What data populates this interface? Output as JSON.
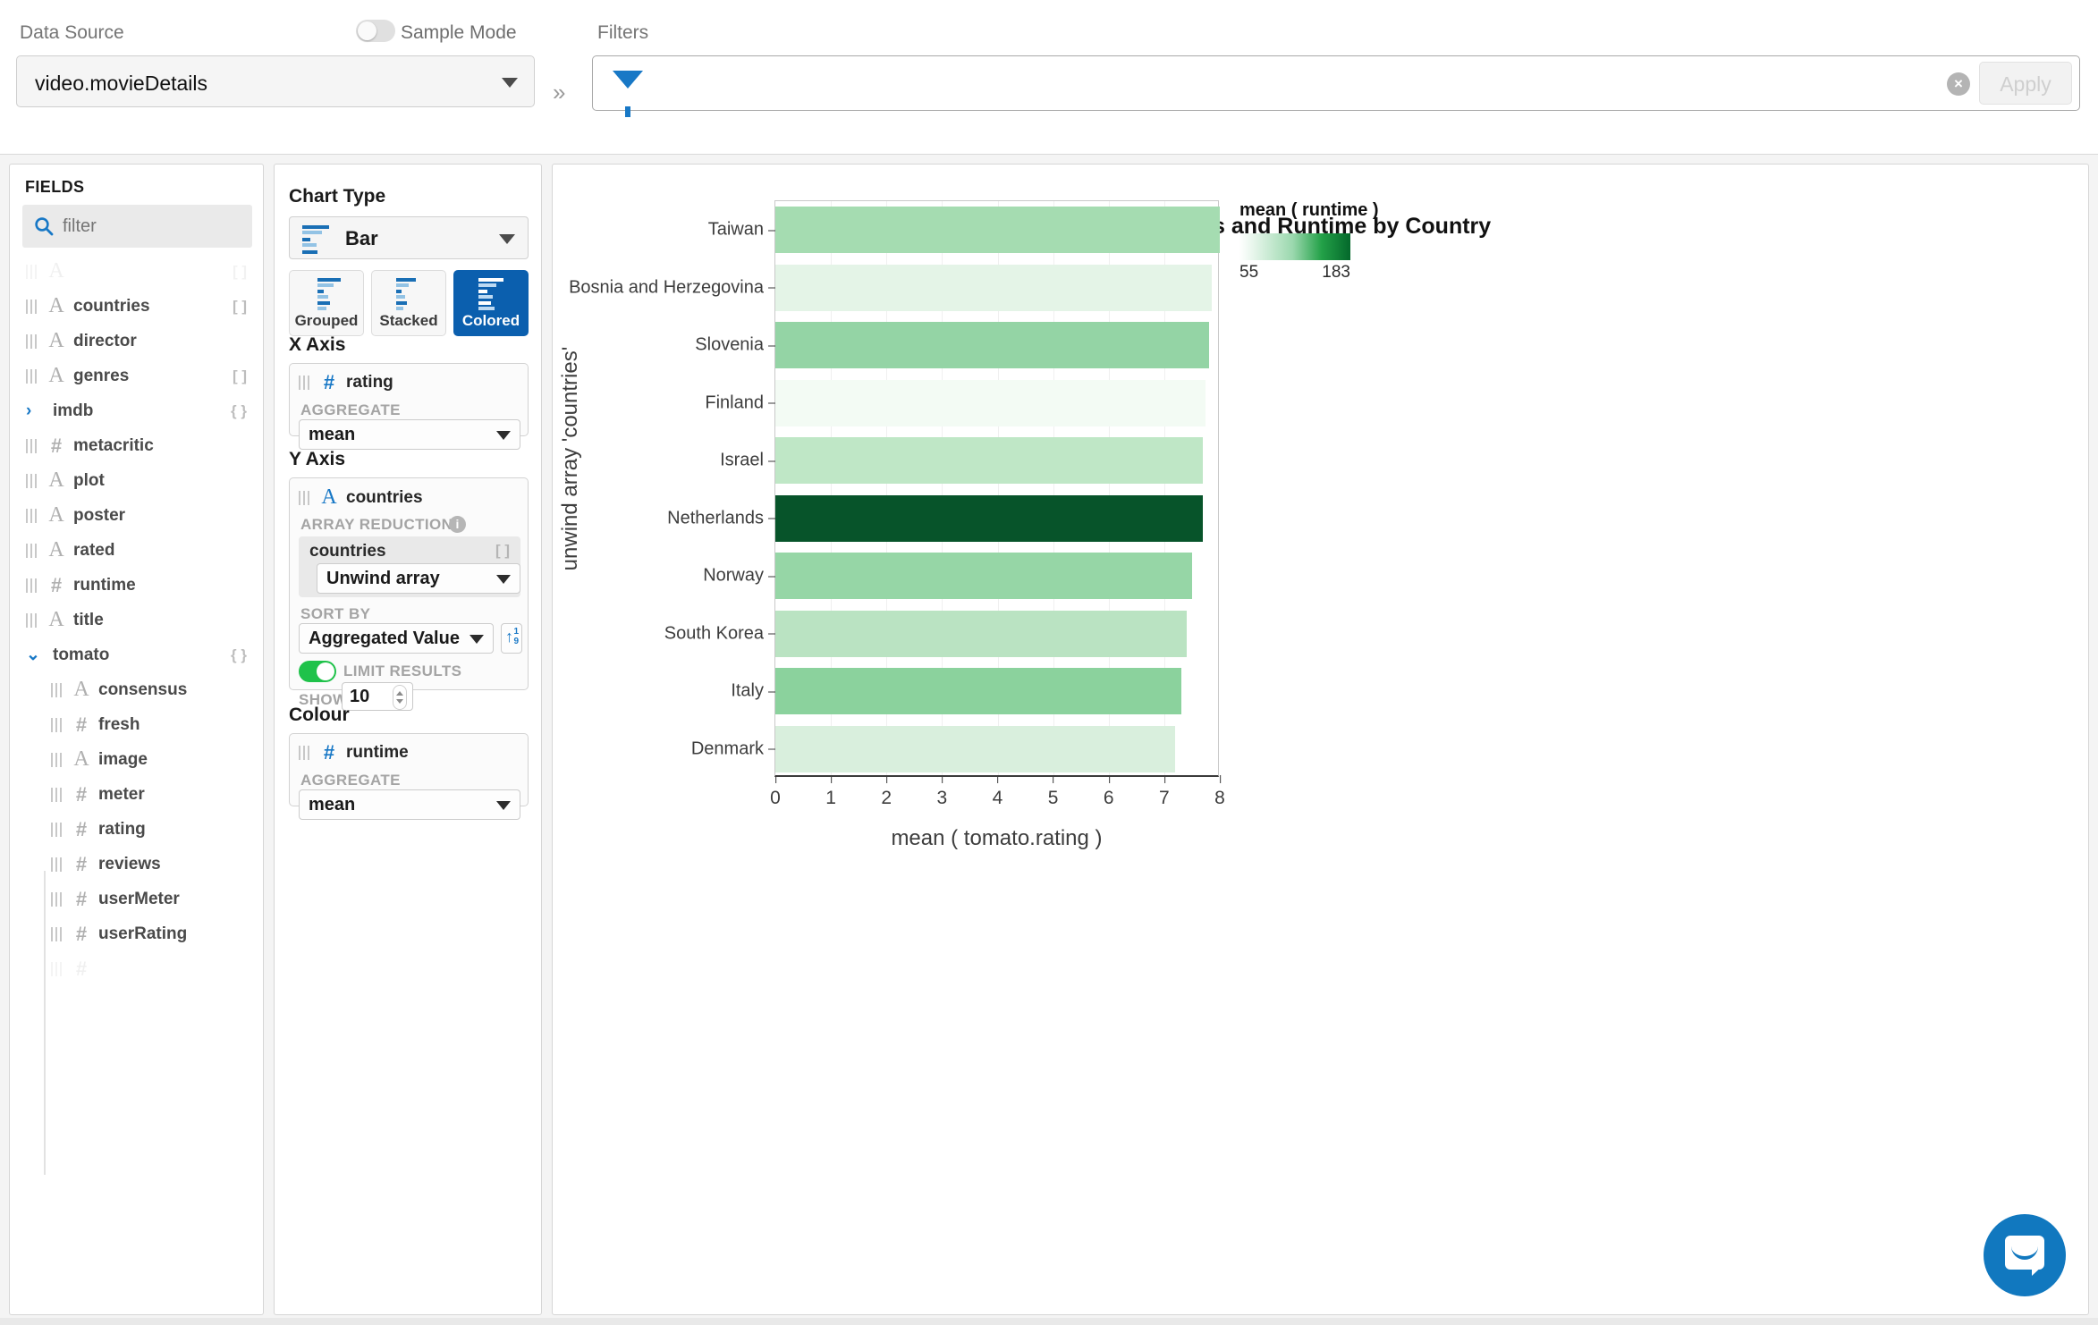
{
  "topbar": {
    "data_source_label": "Data Source",
    "data_source_value": "video.movieDetails",
    "sample_mode_label": "Sample Mode",
    "sample_mode_on": false,
    "expand_icon": "»",
    "filters_label": "Filters",
    "filter_clear_icon": "×",
    "apply_label": "Apply"
  },
  "fields": {
    "title": "FIELDS",
    "filter_placeholder": "filter",
    "items": [
      {
        "name": "",
        "type": "string",
        "bracket": "[ ]",
        "indent": 0,
        "faded": true,
        "expander": ""
      },
      {
        "name": "countries",
        "type": "string",
        "bracket": "[ ]",
        "indent": 0,
        "faded": false,
        "expander": ""
      },
      {
        "name": "director",
        "type": "string",
        "bracket": "",
        "indent": 0,
        "faded": false,
        "expander": ""
      },
      {
        "name": "genres",
        "type": "string",
        "bracket": "[ ]",
        "indent": 0,
        "faded": false,
        "expander": ""
      },
      {
        "name": "imdb",
        "type": "object",
        "bracket": "{ }",
        "indent": 0,
        "faded": false,
        "expander": "›"
      },
      {
        "name": "metacritic",
        "type": "number",
        "bracket": "",
        "indent": 0,
        "faded": false,
        "expander": ""
      },
      {
        "name": "plot",
        "type": "string",
        "bracket": "",
        "indent": 0,
        "faded": false,
        "expander": ""
      },
      {
        "name": "poster",
        "type": "string",
        "bracket": "",
        "indent": 0,
        "faded": false,
        "expander": ""
      },
      {
        "name": "rated",
        "type": "string",
        "bracket": "",
        "indent": 0,
        "faded": false,
        "expander": ""
      },
      {
        "name": "runtime",
        "type": "number",
        "bracket": "",
        "indent": 0,
        "faded": false,
        "expander": ""
      },
      {
        "name": "title",
        "type": "string",
        "bracket": "",
        "indent": 0,
        "faded": false,
        "expander": ""
      },
      {
        "name": "tomato",
        "type": "object",
        "bracket": "{ }",
        "indent": 0,
        "faded": false,
        "expander": "⌄"
      },
      {
        "name": "consensus",
        "type": "string",
        "bracket": "",
        "indent": 1,
        "faded": false,
        "expander": ""
      },
      {
        "name": "fresh",
        "type": "number",
        "bracket": "",
        "indent": 1,
        "faded": false,
        "expander": ""
      },
      {
        "name": "image",
        "type": "string",
        "bracket": "",
        "indent": 1,
        "faded": false,
        "expander": ""
      },
      {
        "name": "meter",
        "type": "number",
        "bracket": "",
        "indent": 1,
        "faded": false,
        "expander": ""
      },
      {
        "name": "rating",
        "type": "number",
        "bracket": "",
        "indent": 1,
        "faded": false,
        "expander": ""
      },
      {
        "name": "reviews",
        "type": "number",
        "bracket": "",
        "indent": 1,
        "faded": false,
        "expander": ""
      },
      {
        "name": "userMeter",
        "type": "number",
        "bracket": "",
        "indent": 1,
        "faded": false,
        "expander": ""
      },
      {
        "name": "userRating",
        "type": "number",
        "bracket": "",
        "indent": 1,
        "faded": false,
        "expander": ""
      },
      {
        "name": "",
        "type": "number",
        "bracket": "",
        "indent": 1,
        "faded": true,
        "expander": ""
      }
    ]
  },
  "config": {
    "chart_type_heading": "Chart Type",
    "chart_type_value": "Bar",
    "variants": [
      {
        "label": "Grouped",
        "active": false
      },
      {
        "label": "Stacked",
        "active": false
      },
      {
        "label": "Colored",
        "active": true
      }
    ],
    "x_axis": {
      "heading": "X Axis",
      "field": "rating",
      "field_type": "number",
      "aggregate_label": "AGGREGATE",
      "aggregate_value": "mean"
    },
    "y_axis": {
      "heading": "Y Axis",
      "field": "countries",
      "field_type": "string",
      "array_reductions_label": "ARRAY REDUCTIONS",
      "info_icon": "i",
      "reduction_field": "countries",
      "reduction_bracket": "[ ]",
      "reduction_value": "Unwind array",
      "sort_by_label": "SORT BY",
      "sort_by_value": "Aggregated Value",
      "sort_dir_icon": "↑",
      "sort_dir_nums": "1\n9",
      "limit_results_label": "LIMIT RESULTS",
      "limit_results_on": true,
      "show_label": "SHOW:",
      "show_value": "10"
    },
    "colour": {
      "heading": "Colour",
      "field": "runtime",
      "field_type": "number",
      "aggregate_label": "AGGREGATE",
      "aggregate_value": "mean"
    }
  },
  "chart_data": {
    "type": "bar",
    "orientation": "horizontal",
    "title": "Average Movie Ratings and Runtime by Country",
    "xlabel": "mean ( tomato.rating )",
    "ylabel": "unwind array 'countries'",
    "xlim": [
      0,
      8
    ],
    "xticks": [
      "0",
      "1",
      "2",
      "3",
      "4",
      "5",
      "6",
      "7",
      "8"
    ],
    "grid": true,
    "categories": [
      "Taiwan",
      "Bosnia and Herzegovina",
      "Slovenia",
      "Finland",
      "Israel",
      "Netherlands",
      "Norway",
      "South Korea",
      "Italy",
      "Denmark"
    ],
    "values": [
      8.0,
      7.85,
      7.8,
      7.75,
      7.7,
      7.7,
      7.5,
      7.4,
      7.3,
      7.2
    ],
    "colour_values": [
      118,
      72,
      130,
      60,
      105,
      183,
      126,
      100,
      135,
      85
    ],
    "colour_legend": {
      "title": "mean ( runtime )",
      "min": "55",
      "max": "183",
      "position": "right",
      "colormap": "Greens"
    },
    "bar_colors": [
      "#a5dcb1",
      "#e4f4e7",
      "#94d4a5",
      "#f3fbf4",
      "#bfe7c6",
      "#07542a",
      "#96d6a6",
      "#bae3c2",
      "#8bd29d",
      "#d9efdd"
    ]
  },
  "chat": {
    "icon": "chat-bubble-icon"
  }
}
